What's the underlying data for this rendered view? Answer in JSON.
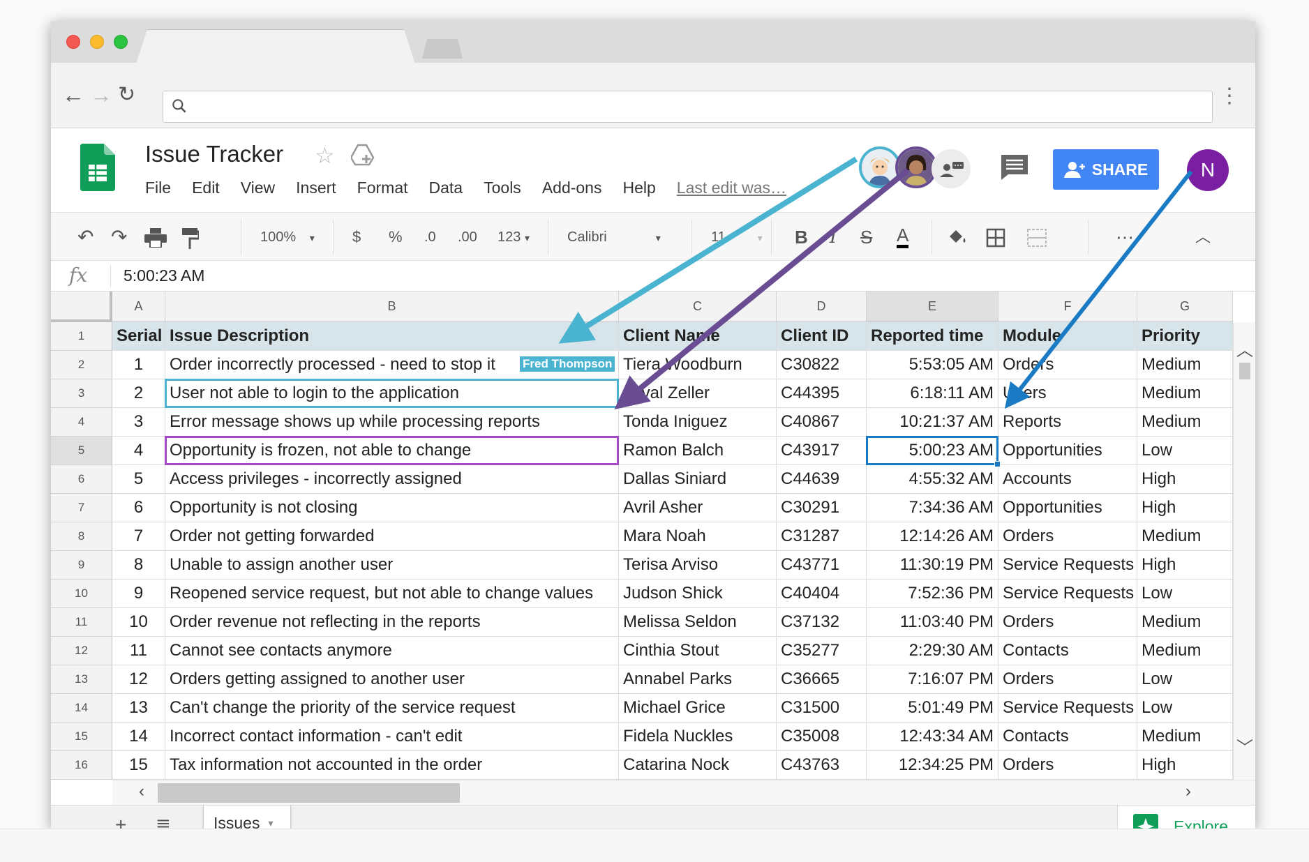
{
  "document": {
    "title": "Issue Tracker",
    "menu": [
      "File",
      "Edit",
      "View",
      "Insert",
      "Format",
      "Data",
      "Tools",
      "Add-ons",
      "Help"
    ],
    "last_edit": "Last edit was…"
  },
  "header": {
    "share_label": "SHARE",
    "user_initial": "N"
  },
  "toolbar": {
    "zoom": "100%",
    "currency": "$",
    "percent": "%",
    "decrease_decimal": ".0",
    "increase_decimal": ".00",
    "more_formats": "123",
    "font": "Calibri",
    "font_size": "11",
    "bold": "B",
    "italic": "I",
    "strike": "S",
    "text_color": "A"
  },
  "formula_bar": {
    "label": "fx",
    "value": "5:00:23 AM"
  },
  "columns": [
    "A",
    "B",
    "C",
    "D",
    "E",
    "F",
    "G"
  ],
  "row_numbers": [
    "1",
    "2",
    "3",
    "4",
    "5",
    "6",
    "7",
    "8",
    "9",
    "10",
    "11",
    "12",
    "13",
    "14",
    "15",
    "16"
  ],
  "header_row": [
    "Serial #",
    "Issue Description",
    "Client Name",
    "Client ID",
    "Reported time",
    "Module",
    "Priority"
  ],
  "rows": [
    [
      "1",
      "Order incorrectly processed - need to stop it",
      "Tiera Woodburn",
      "C30822",
      "5:53:05 AM",
      "Orders",
      "Medium"
    ],
    [
      "2",
      "User not able to login to the application",
      "Orval Zeller",
      "C44395",
      "6:18:11 AM",
      "Users",
      "Medium"
    ],
    [
      "3",
      "Error message shows up while processing reports",
      "Tonda Iniguez",
      "C40867",
      "10:21:37 AM",
      "Reports",
      "Medium"
    ],
    [
      "4",
      "Opportunity is frozen, not able to change",
      "Ramon Balch",
      "C43917",
      "5:00:23 AM",
      "Opportunities",
      "Low"
    ],
    [
      "5",
      "Access privileges - incorrectly assigned",
      "Dallas Siniard",
      "C44639",
      "4:55:32 AM",
      "Accounts",
      "High"
    ],
    [
      "6",
      "Opportunity is not closing",
      "Avril Asher",
      "C30291",
      "7:34:36 AM",
      "Opportunities",
      "High"
    ],
    [
      "7",
      "Order not getting forwarded",
      "Mara Noah",
      "C31287",
      "12:14:26 AM",
      "Orders",
      "Medium"
    ],
    [
      "8",
      "Unable to assign another user",
      "Terisa Arviso",
      "C43771",
      "11:30:19 PM",
      "Service Requests",
      "High"
    ],
    [
      "9",
      "Reopened service request, but not able to change values",
      "Judson Shick",
      "C40404",
      "7:52:36 PM",
      "Service Requests",
      "Low"
    ],
    [
      "10",
      "Order revenue not reflecting in the reports",
      "Melissa Seldon",
      "C37132",
      "11:03:40 PM",
      "Orders",
      "Medium"
    ],
    [
      "11",
      "Cannot see contacts anymore",
      "Cinthia Stout",
      "C35277",
      "2:29:30 AM",
      "Contacts",
      "Medium"
    ],
    [
      "12",
      "Orders getting assigned to another user",
      "Annabel Parks",
      "C36665",
      "7:16:07 PM",
      "Orders",
      "Low"
    ],
    [
      "13",
      "Can't change the priority of the service request",
      "Michael Grice",
      "C31500",
      "5:01:49 PM",
      "Service Requests",
      "Low"
    ],
    [
      "14",
      "Incorrect contact information - can't edit",
      "Fidela Nuckles",
      "C35008",
      "12:43:34 AM",
      "Contacts",
      "Medium"
    ],
    [
      "15",
      "Tax information not accounted in the order",
      "Catarina Nock",
      "C43763",
      "12:34:25 PM",
      "Orders",
      "High"
    ]
  ],
  "collaborator_tag": "Fred Thompson",
  "sheet_tabs": [
    "Issues"
  ],
  "explore_label": "Explore",
  "colors": {
    "share_blue": "#4285f4",
    "header_fill": "#d7e4e9",
    "collab_teal": "#4ab3d0",
    "collab_purple": "#6a4c93",
    "collab_blue": "#1a7bc4",
    "user_purple": "#7b1fa2",
    "sheets_green": "#0f9d58"
  }
}
